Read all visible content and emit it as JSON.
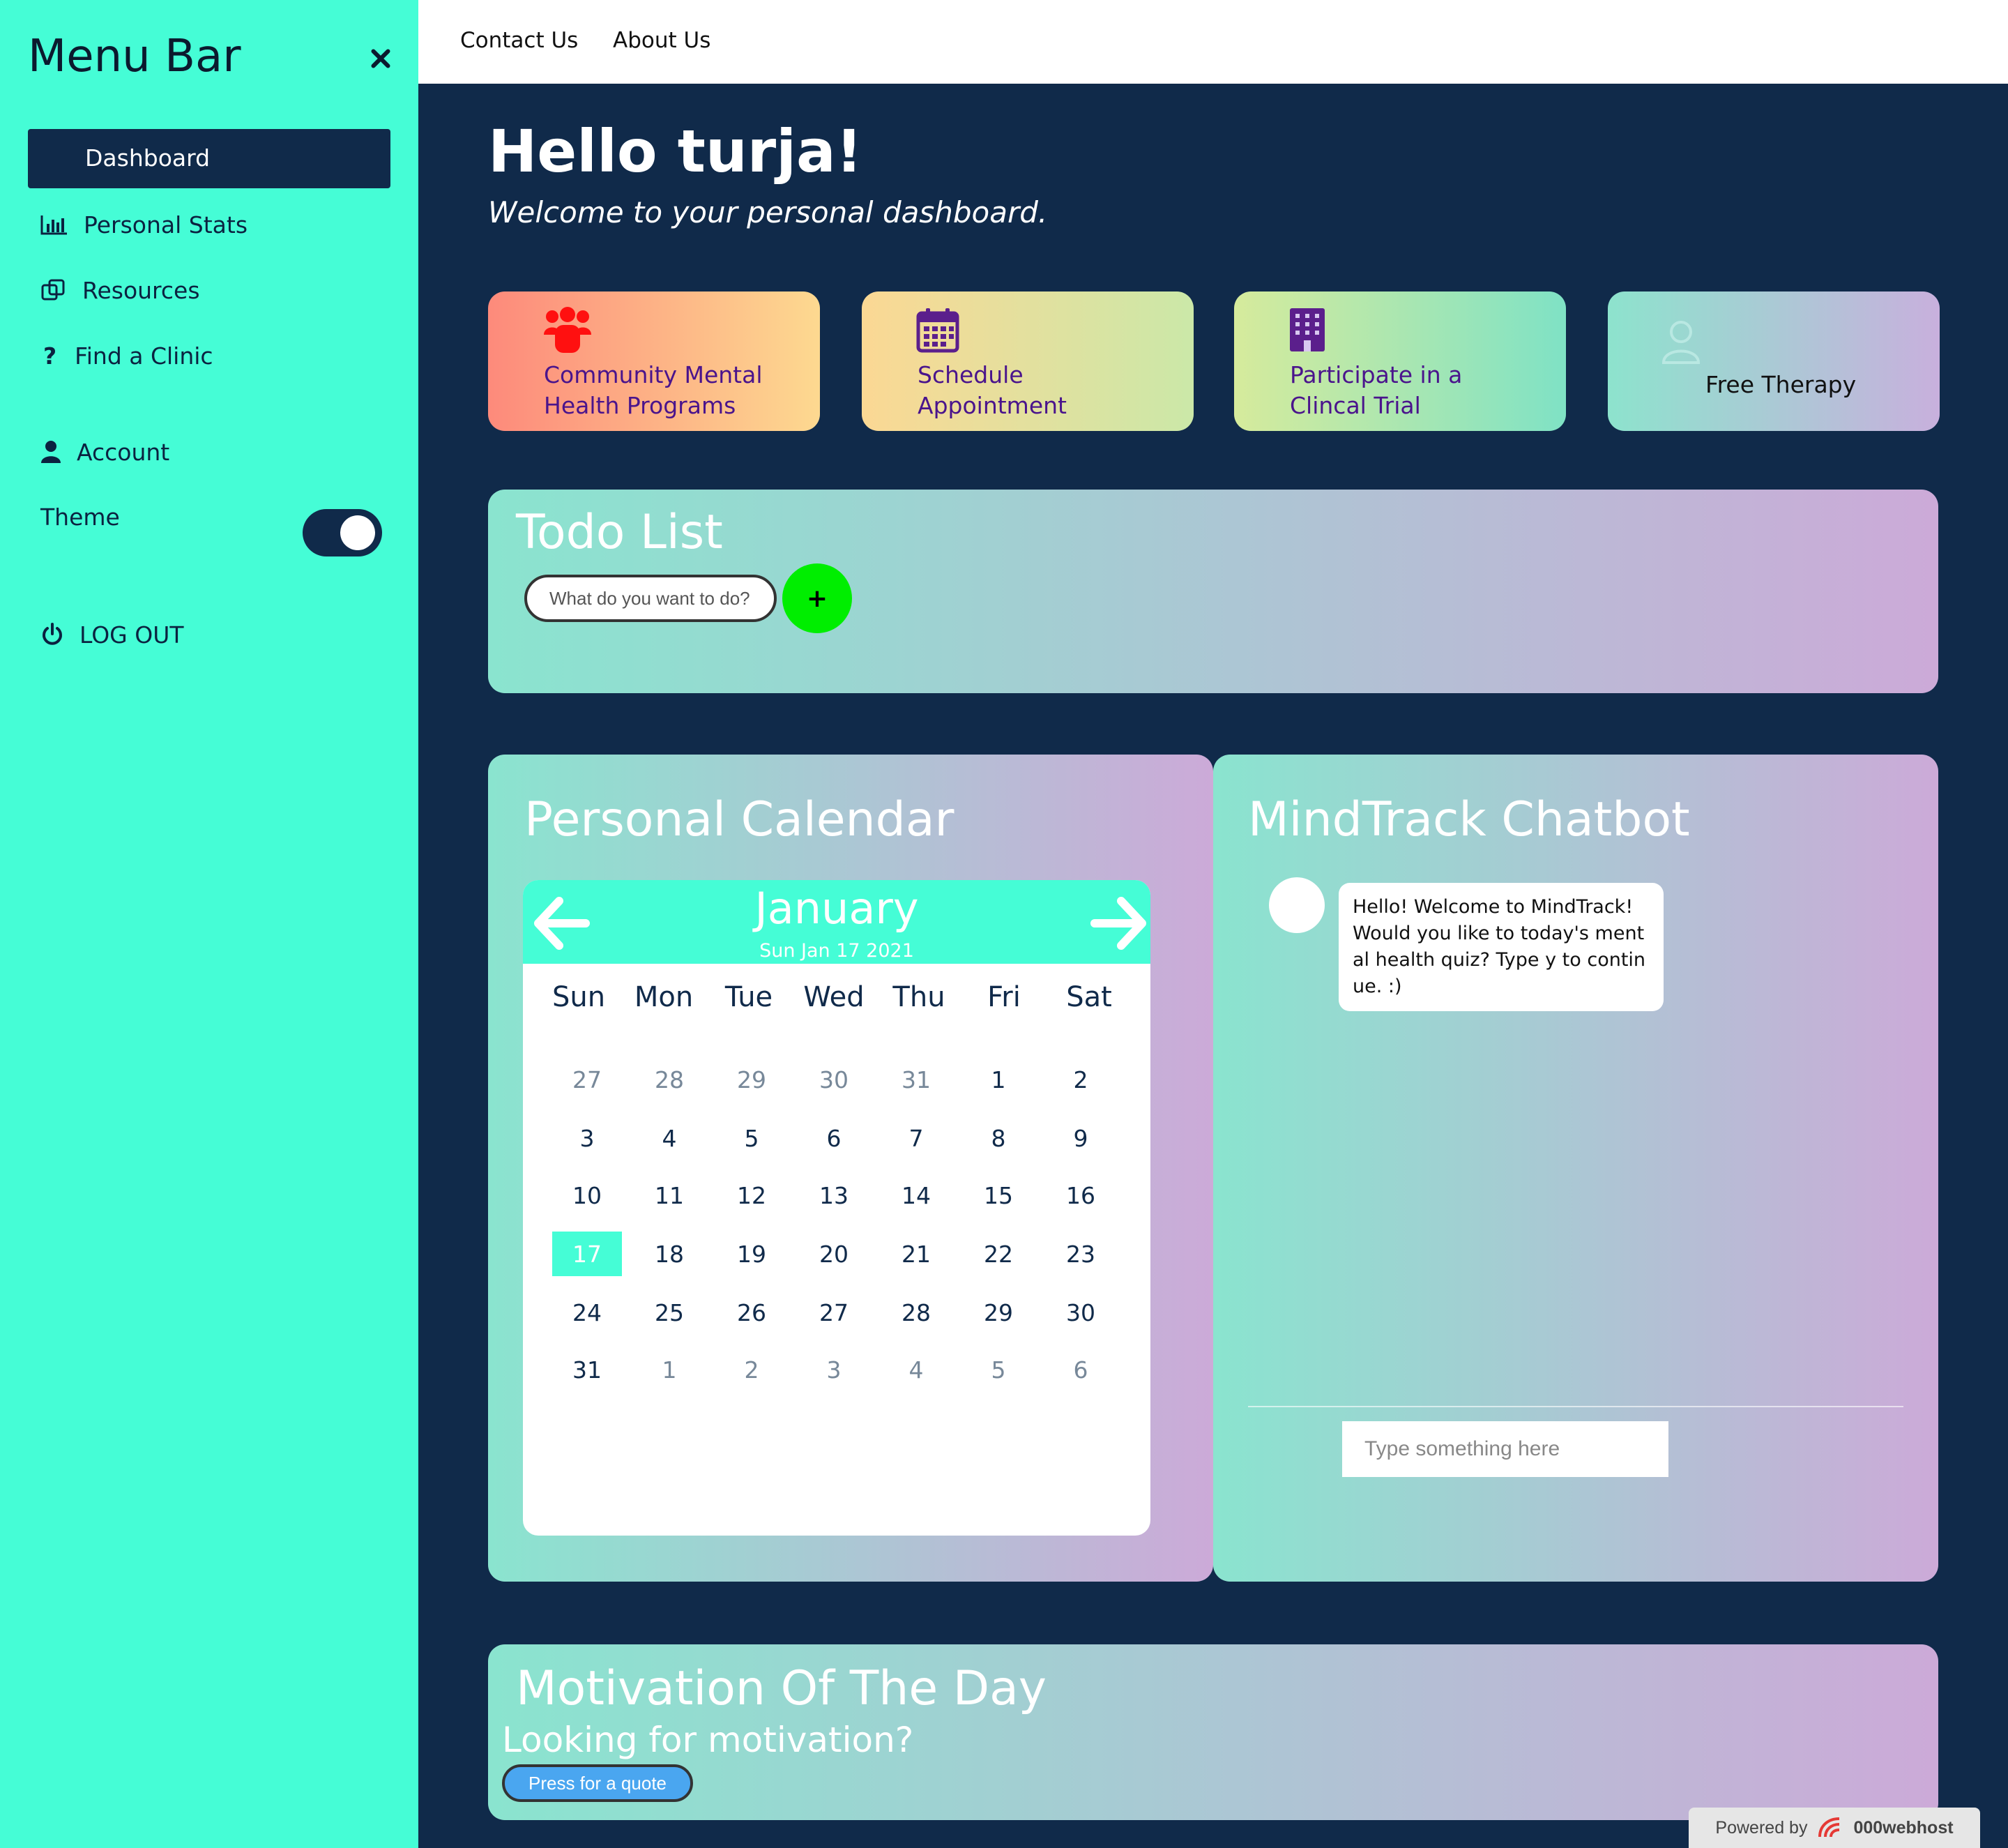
{
  "sidebar": {
    "title": "Menu Bar",
    "items": [
      {
        "label": "Dashboard",
        "icon": "dashboard"
      },
      {
        "label": "Personal Stats",
        "icon": "bar-chart-icon"
      },
      {
        "label": "Resources",
        "icon": "copy-icon"
      },
      {
        "label": "Find a Clinic",
        "icon": "question-icon"
      },
      {
        "label": "Account",
        "icon": "user-icon"
      }
    ],
    "theme_label": "Theme",
    "logout_label": "LOG OUT"
  },
  "topnav": {
    "links": [
      "Contact Us",
      "About Us"
    ]
  },
  "main": {
    "greeting": "Hello turja!",
    "subgreeting": "Welcome to your personal dashboard.",
    "cards": [
      {
        "line1": "Community Mental",
        "line2": "Health Programs",
        "icon": "users-icon"
      },
      {
        "line1": "Schedule",
        "line2": "Appointment",
        "icon": "calendar-icon"
      },
      {
        "line1": "Participate in a",
        "line2": "Clincal Trial",
        "icon": "building-icon"
      },
      {
        "line1": "Free Therapy",
        "line2": "",
        "icon": "user-outline-icon"
      }
    ]
  },
  "todo": {
    "title": "Todo List",
    "placeholder": "What do you want to do?",
    "add_label": "+"
  },
  "calendar": {
    "title": "Personal Calendar",
    "month": "January",
    "date": "Sun Jan 17 2021",
    "weekdays": [
      "Sun",
      "Mon",
      "Tue",
      "Wed",
      "Thu",
      "Fri",
      "Sat"
    ],
    "weeks": [
      [
        "27",
        "28",
        "29",
        "30",
        "31",
        "1",
        "2"
      ],
      [
        "3",
        "4",
        "5",
        "6",
        "7",
        "8",
        "9"
      ],
      [
        "10",
        "11",
        "12",
        "13",
        "14",
        "15",
        "16"
      ],
      [
        "17",
        "18",
        "19",
        "20",
        "21",
        "22",
        "23"
      ],
      [
        "24",
        "25",
        "26",
        "27",
        "28",
        "29",
        "30"
      ],
      [
        "31",
        "1",
        "2",
        "3",
        "4",
        "5",
        "6"
      ]
    ],
    "today": "17",
    "accent": "#45fdd6"
  },
  "chatbot": {
    "title": "MindTrack Chatbot",
    "message": "Hello! Welcome to MindTrack! Would you like to today's mental health quiz? Type y to continue. :)",
    "placeholder": "Type something here"
  },
  "motivation": {
    "title": "Motivation Of The Day",
    "subtitle": "Looking for motivation?",
    "button": "Press for a quote"
  },
  "footer": {
    "powered_by": "Powered by",
    "brand": "000webhost"
  },
  "colors": {
    "sidebar": "#45fdd6",
    "background": "#102a4a",
    "add_button": "#00ee00",
    "quote_button": "#4aa6f0"
  }
}
